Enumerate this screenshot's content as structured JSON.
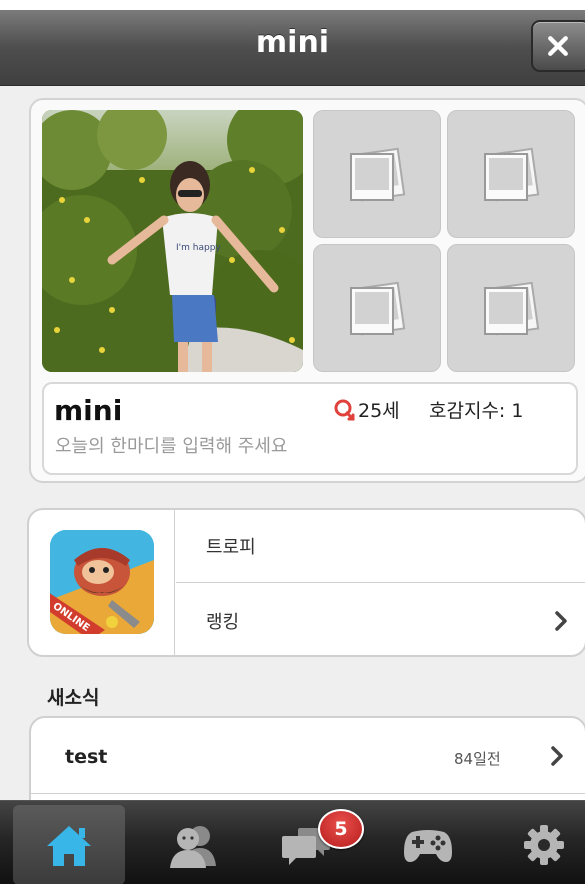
{
  "header": {
    "title": "mini",
    "close_symbol": "close-icon"
  },
  "profile": {
    "name": "mini",
    "age": "25세",
    "affinity": "호감지수: 1",
    "status_placeholder": "오늘의 한마디를 입력해 주세요"
  },
  "game": {
    "rows": [
      {
        "label": "트로피"
      },
      {
        "label": "랭킹"
      }
    ]
  },
  "news": {
    "section_title": "새소식",
    "items": [
      {
        "title": "test",
        "time": "84일전"
      }
    ]
  },
  "tabbar": {
    "badge_count": "5",
    "tabs": [
      "home-icon",
      "friends-icon",
      "chat-icon",
      "game-controller-icon",
      "settings-icon"
    ]
  },
  "colors": {
    "home_active": "#39b6e8",
    "badge": "#c62828",
    "gender_icon": "#e0413b"
  }
}
